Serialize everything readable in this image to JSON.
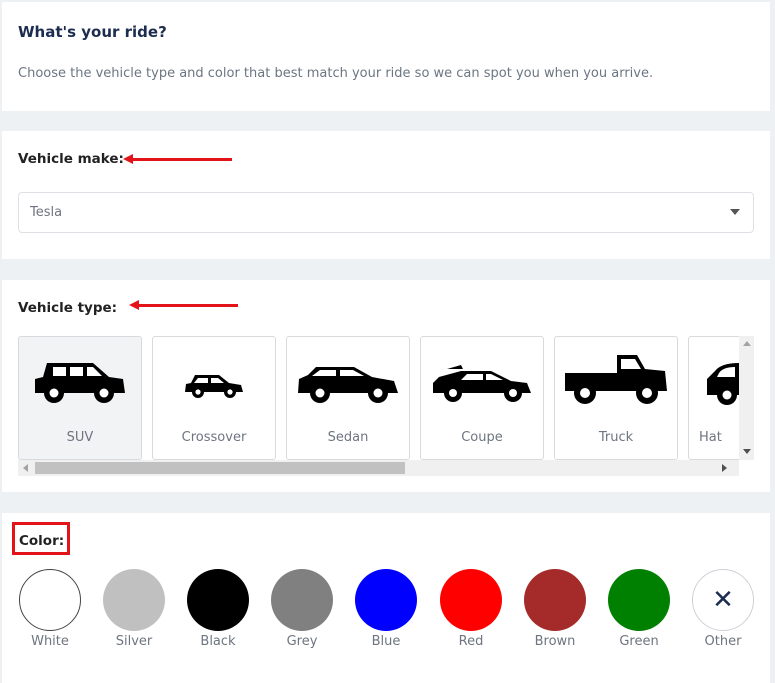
{
  "intro": {
    "title": "What's your ride?",
    "subtitle": "Choose the vehicle type and color that best match your ride so we can spot you when you arrive."
  },
  "make": {
    "label": "Vehicle make:",
    "selected": "Tesla"
  },
  "type": {
    "label": "Vehicle type:",
    "selected": "SUV",
    "items": [
      {
        "label": "SUV",
        "icon": "suv-icon"
      },
      {
        "label": "Crossover",
        "icon": "crossover-icon"
      },
      {
        "label": "Sedan",
        "icon": "sedan-icon"
      },
      {
        "label": "Coupe",
        "icon": "coupe-icon"
      },
      {
        "label": "Truck",
        "icon": "truck-icon"
      },
      {
        "label": "Hat",
        "icon": "hatchback-icon"
      }
    ]
  },
  "color": {
    "label": "Color:",
    "options": [
      {
        "label": "White",
        "hex": "#ffffff"
      },
      {
        "label": "Silver",
        "hex": "#c0c0c0"
      },
      {
        "label": "Black",
        "hex": "#000000"
      },
      {
        "label": "Grey",
        "hex": "#808080"
      },
      {
        "label": "Blue",
        "hex": "#0000ff"
      },
      {
        "label": "Red",
        "hex": "#ff0000"
      },
      {
        "label": "Brown",
        "hex": "#a52a2a"
      },
      {
        "label": "Green",
        "hex": "#008000"
      },
      {
        "label": "Other",
        "icon": "close-icon",
        "glyph": "✕"
      }
    ]
  },
  "annotation_color": "#e3131a",
  "accent": "#1d2d50"
}
